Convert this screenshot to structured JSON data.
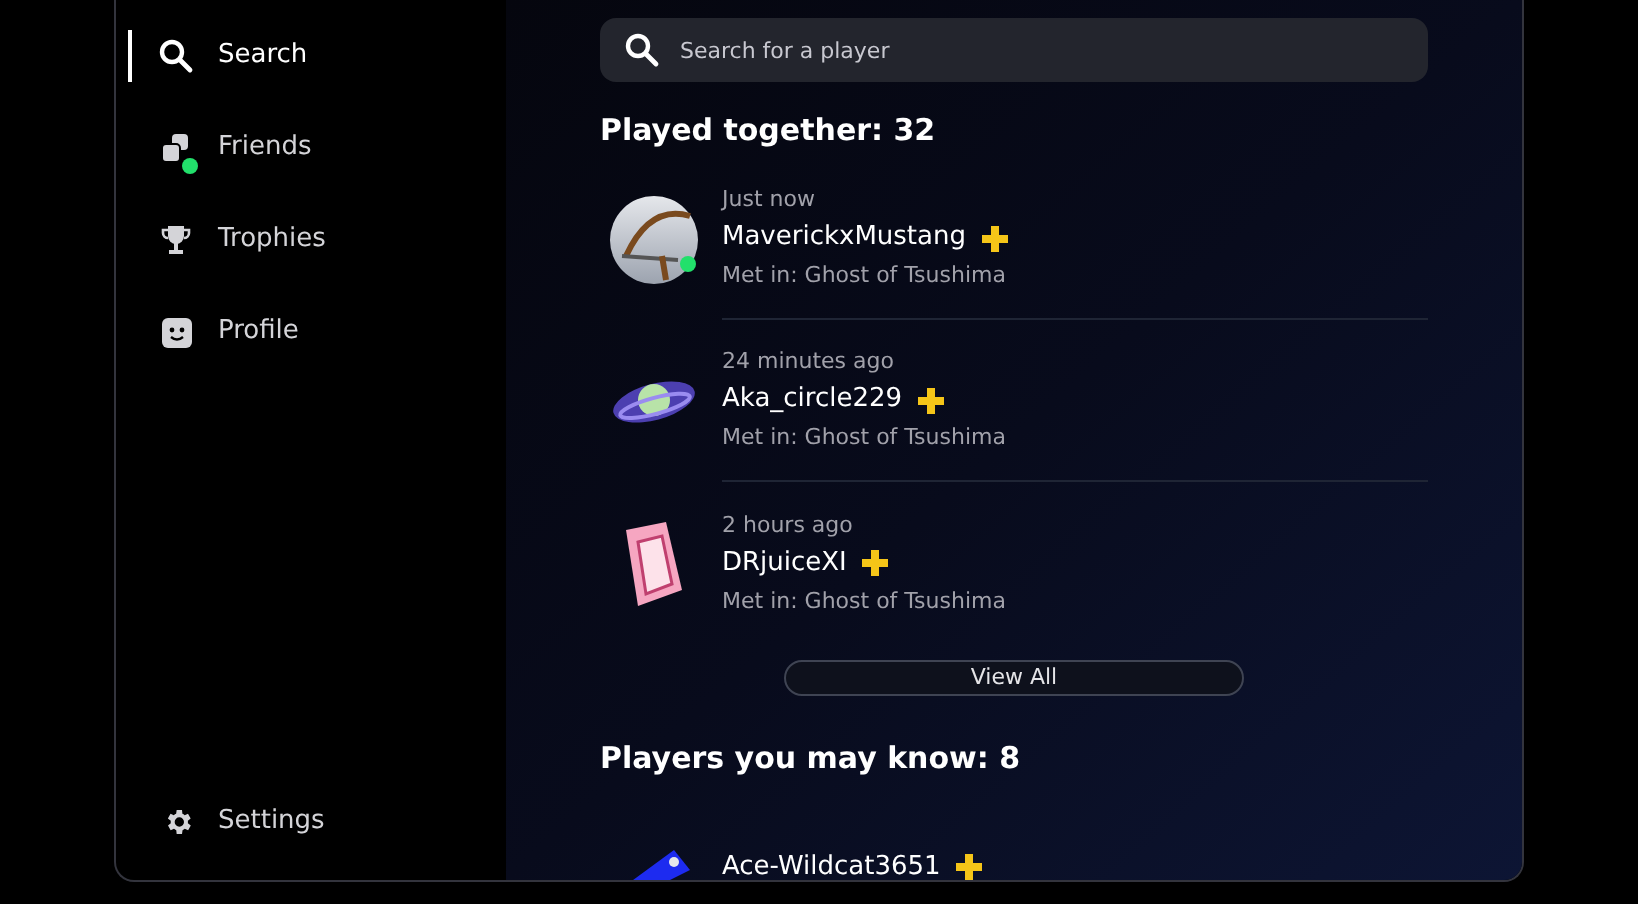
{
  "sidebar": {
    "items": [
      {
        "kind": "search",
        "label": "Search",
        "selected": true,
        "badge": false
      },
      {
        "kind": "friends",
        "label": "Friends",
        "selected": false,
        "badge": true
      },
      {
        "kind": "trophies",
        "label": "Trophies",
        "selected": false,
        "badge": false
      },
      {
        "kind": "profile",
        "label": "Profile",
        "selected": false,
        "badge": false
      }
    ],
    "footer": {
      "kind": "settings",
      "label": "Settings"
    }
  },
  "search": {
    "placeholder": "Search for a player"
  },
  "played_together": {
    "title": "Played together: 32",
    "players": [
      {
        "time": "Just now",
        "name": "MaverickxMustang",
        "plus": true,
        "online": true,
        "met": "Met in: Ghost of Tsushima"
      },
      {
        "time": "24 minutes ago",
        "name": "Aka_circle229",
        "plus": true,
        "online": false,
        "met": "Met in: Ghost of Tsushima"
      },
      {
        "time": "2 hours ago",
        "name": "DRjuiceXI",
        "plus": true,
        "online": false,
        "met": "Met in: Ghost of Tsushima"
      }
    ],
    "button": "View All"
  },
  "may_know": {
    "title": "Players you may know: 8",
    "players": [
      {
        "name": "Ace-Wildcat3651",
        "plus": true,
        "online": false
      }
    ]
  }
}
